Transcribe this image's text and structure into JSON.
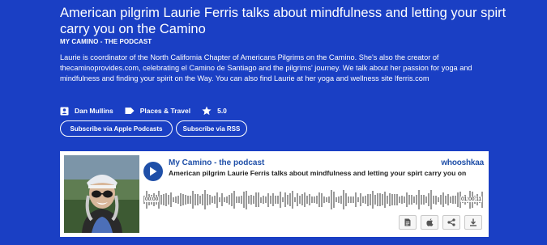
{
  "episode": {
    "title": "American pilgrim Laurie Ferris talks about mindfulness and letting your spirt carry you on the Camino",
    "podcast_name": "MY CAMINO - THE PODCAST",
    "description": "Laurie is coordinator of the North California Chapter of Americans Pilgrims on the Camino. She's also the creator of thecaminoprovides.com, celebrating el Camino de Santiago and the pilgrims' journey. We talk about her passion for yoga and mindfulness and finding your spirit on the Way. You can also find Laurie at her yoga and wellness site lferris.com"
  },
  "meta": {
    "author": "Dan Mullins",
    "author_icon": "person-icon",
    "category": "Places & Travel",
    "category_icon": "tag-icon",
    "rating": "5.0",
    "rating_icon": "star-icon"
  },
  "buttons": {
    "apple": "Subscribe via Apple Podcasts",
    "rss": "Subscribe via RSS"
  },
  "player": {
    "podcast_title": "My Camino - the podcast",
    "episode_title": "American pilgrim Laurie Ferris talks about mindfulness and letting your spirt carry you on",
    "brand": "whooshkaa",
    "time_start": "00:00",
    "time_end": "01:00:11",
    "actions": [
      "document-icon",
      "apple-icon",
      "share-icon",
      "download-icon"
    ]
  },
  "colors": {
    "background": "#1a3fc4",
    "player_accent": "#1f4fa8",
    "waveform": "#9a9a9a"
  }
}
